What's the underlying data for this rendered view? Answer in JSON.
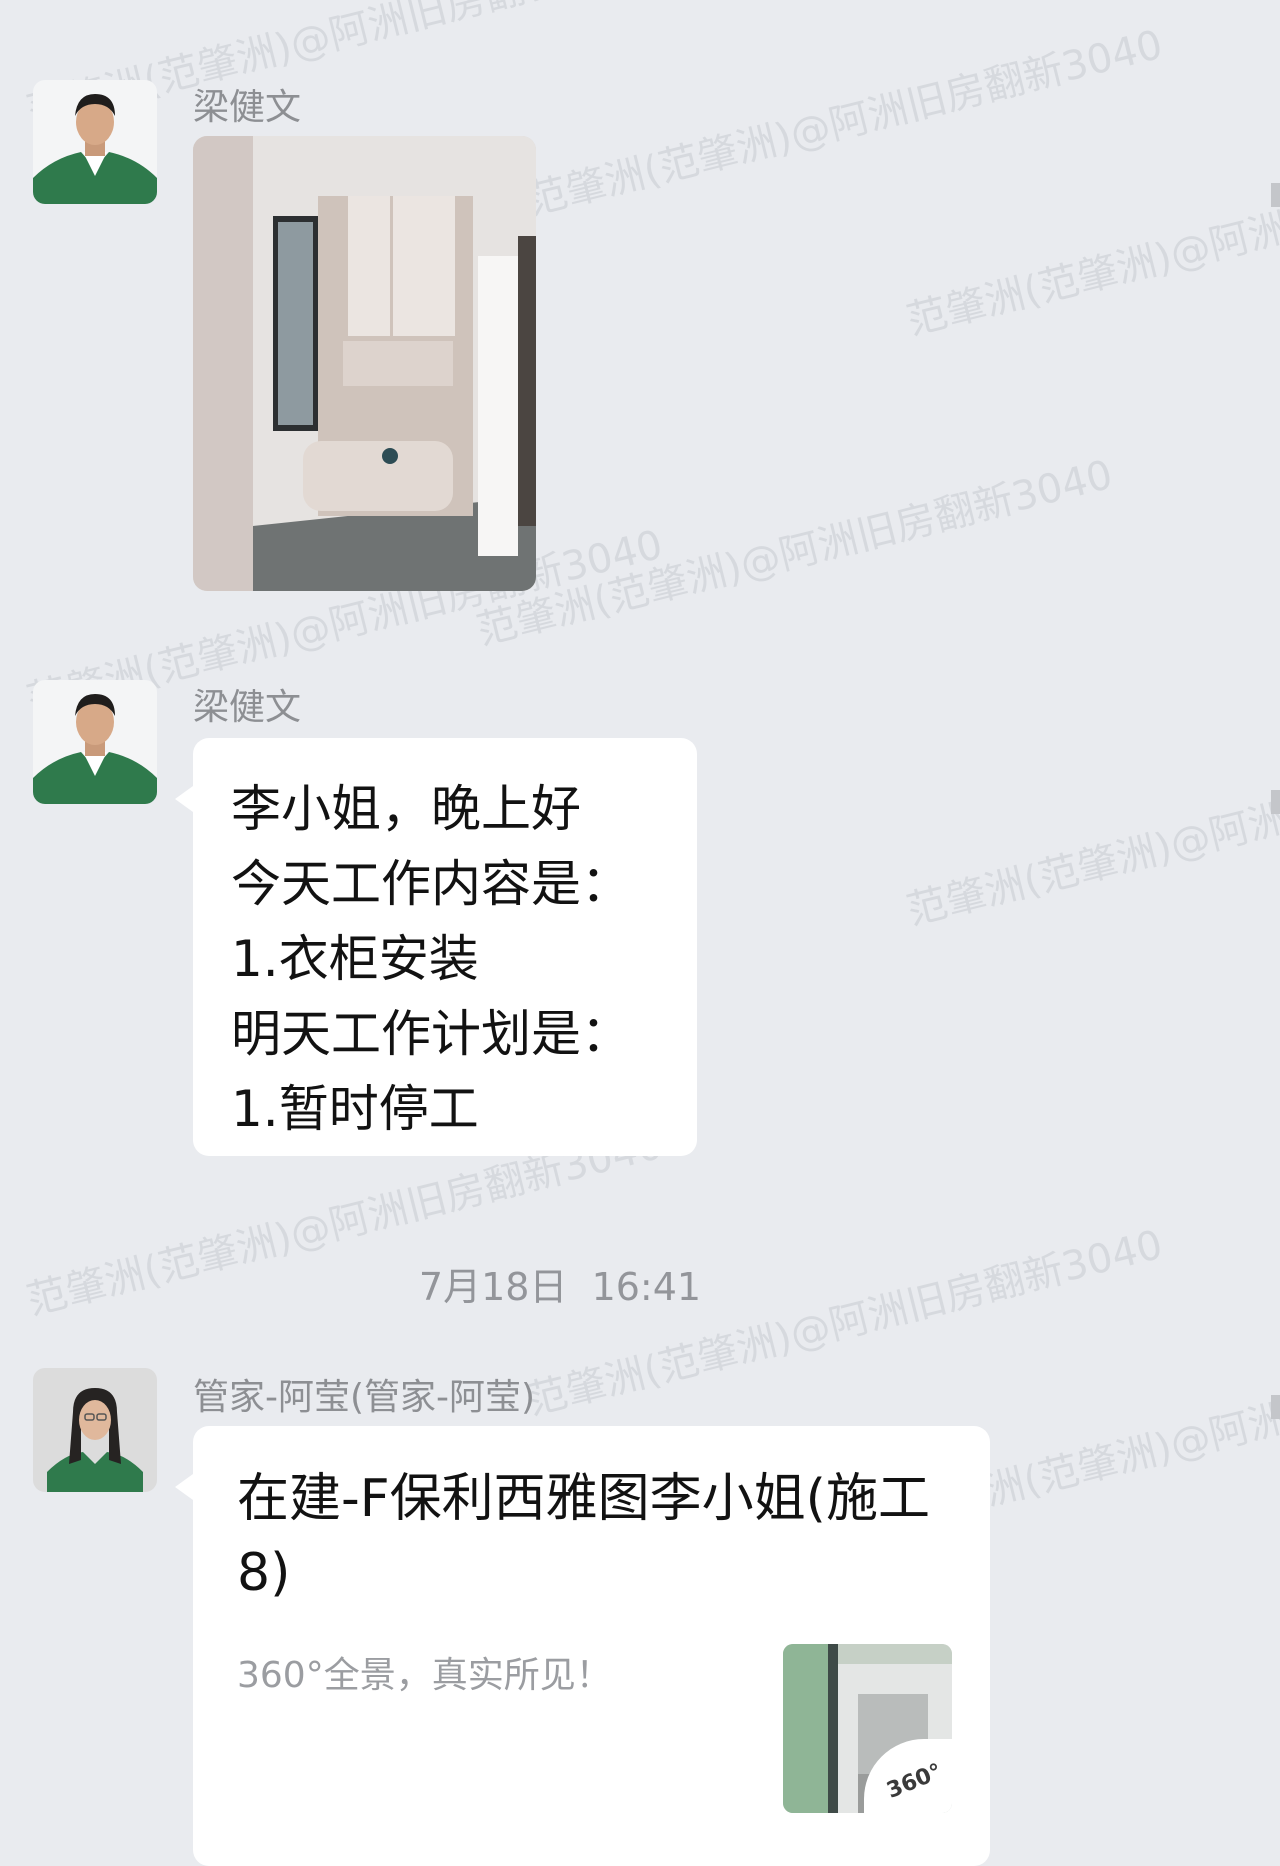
{
  "watermark": "范肇洲(范肇洲)@阿洲旧房翻新3040",
  "messages": [
    {
      "sender": "梁健文",
      "avatar": "man-avatar",
      "type": "image",
      "image": "wardrobe-photo"
    },
    {
      "sender": "梁健文",
      "avatar": "man-avatar",
      "type": "text",
      "lines": [
        "李小姐，晚上好",
        "今天工作内容是：",
        "1.衣柜安装",
        "明天工作计划是：",
        "1.暂时停工"
      ]
    }
  ],
  "timestamp": "7月18日  16:41",
  "card_message": {
    "sender": "管家-阿莹(管家-阿莹)",
    "avatar": "woman-avatar",
    "title": "在建-F保利西雅图李小姐(施工8)",
    "description": "360°全景，真实所见！",
    "thumbnail": "panorama-thumbnail",
    "badge": "360°"
  },
  "colors": {
    "background": "#e9ebef",
    "bubble": "#ffffff",
    "sender": "#8d8f93",
    "uniform_green": "#2f7a4c"
  }
}
